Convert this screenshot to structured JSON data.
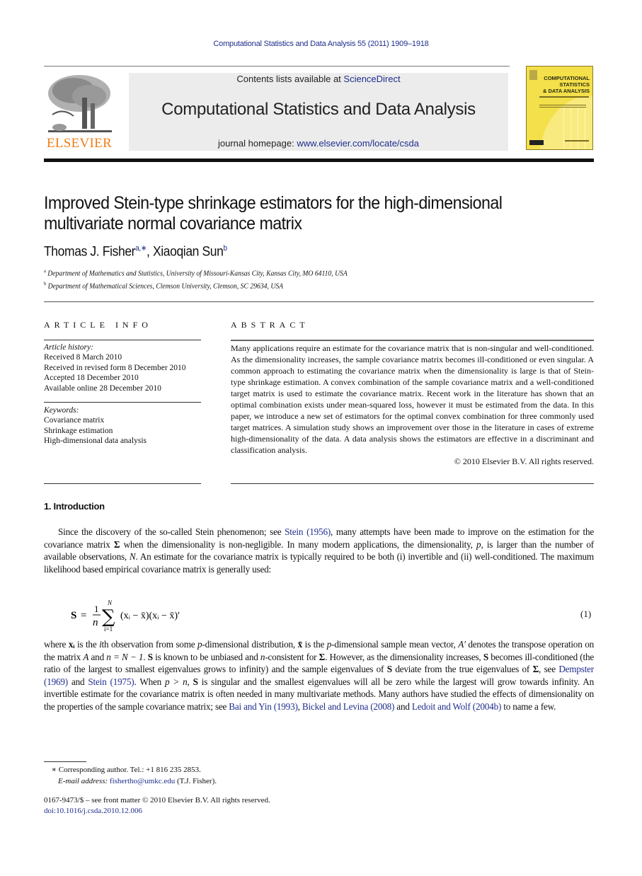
{
  "header": {
    "running_head": "Computational Statistics and Data Analysis 55 (2011) 1909–1918",
    "publisher_logo_text": "ELSEVIER",
    "contents_prefix": "Contents lists available at ",
    "contents_link": "ScienceDirect",
    "journal_title": "Computational Statistics and Data Analysis",
    "homepage_prefix": "journal homepage: ",
    "homepage_link": "www.elsevier.com/locate/csda",
    "cover": {
      "line1": "COMPUTATIONAL",
      "line2": "STATISTICS",
      "line3": "& DATA ANALYSIS",
      "color": "#f3e04a"
    },
    "colors": {
      "link": "#1f2e8c",
      "elsevier_orange": "#f07d1a",
      "banner_bg": "#ececec"
    }
  },
  "article": {
    "title_line1": "Improved Stein-type shrinkage estimators for the high-dimensional",
    "title_line2": "multivariate normal covariance matrix",
    "author1": "Thomas J. Fisher",
    "author1_sup": "a,∗",
    "author_sep": ", ",
    "author2": "Xiaoqian Sun",
    "author2_sup": "b",
    "affiliations": [
      {
        "mark": "a",
        "text": "Department of Mathematics and Statistics, University of Missouri-Kansas City, Kansas City, MO 64110, USA"
      },
      {
        "mark": "b",
        "text": "Department of Mathematical Sciences, Clemson University, Clemson, SC 29634, USA"
      }
    ]
  },
  "article_info": {
    "heading": "ARTICLE INFO",
    "history_label": "Article history:",
    "history": [
      "Received 8 March 2010",
      "Received in revised form 8 December 2010",
      "Accepted 18 December 2010",
      "Available online 28 December 2010"
    ],
    "keywords_label": "Keywords:",
    "keywords": [
      "Covariance matrix",
      "Shrinkage estimation",
      "High-dimensional data analysis"
    ]
  },
  "abstract": {
    "heading": "ABSTRACT",
    "text": "Many applications require an estimate for the covariance matrix that is non-singular and well-conditioned. As the dimensionality increases, the sample covariance matrix becomes ill-conditioned or even singular. A common approach to estimating the covariance matrix when the dimensionality is large is that of Stein-type shrinkage estimation. A convex combination of the sample covariance matrix and a well-conditioned target matrix is used to estimate the covariance matrix. Recent work in the literature has shown that an optimal combination exists under mean-squared loss, however it must be estimated from the data. In this paper, we introduce a new set of estimators for the optimal convex combination for three commonly used target matrices. A simulation study shows an improvement over those in the literature in cases of extreme high-dimensionality of the data. A data analysis shows the estimators are effective in a discriminant and classification analysis.",
    "copyright": "© 2010 Elsevier B.V. All rights reserved."
  },
  "intro": {
    "heading": "1.  Introduction",
    "p1": {
      "a": "Since the discovery of the so-called Stein phenomenon; see ",
      "ref1": "Stein (1956)",
      "b": ", many attempts have been made to improve on the estimation for the covariance matrix ",
      "sigma": "Σ",
      "c": " when the dimensionality is non-negligible. In many modern applications, the dimensionality, ",
      "p": "p",
      "d": ", is larger than the number of available observations, ",
      "N": "N",
      "e": ". An estimate for the covariance matrix is typically required to be both (i) invertible and (ii) well-conditioned. The maximum likelihood based empirical covariance matrix is generally used:"
    },
    "equation": {
      "lhs": "S",
      "eq": "=",
      "frac_num": "1",
      "frac_den": "n",
      "sum_upper": "N",
      "sum_lower": "i=1",
      "body": "(x",
      "body_text": "(xᵢ − x̄)(xᵢ − x̄)′",
      "number": "(1)"
    },
    "p2": {
      "t1": "where ",
      "t2": " is the ",
      "t3": "th observation from some ",
      "t4": "-dimensional distribution, ",
      "t5": " is the ",
      "t6": "-dimensional sample mean vector, ",
      "t7": " denotes the transpose operation on the matrix ",
      "t8": " and ",
      "t9": ". ",
      "t10": " is known to be unbiased and ",
      "t11": "-consistent for ",
      "t12": ". However, as the dimensionality increases, ",
      "t13": " becomes ill-conditioned (the ratio of the largest to smallest eigenvalues grows to infinity) and the sample eigenvalues of ",
      "t14": " deviate from the true eigenvalues of ",
      "t15": ", see ",
      "ref_dempster": "Dempster (1969)",
      "t16": " and ",
      "ref_stein1975": "Stein (1975)",
      "t17": ". When ",
      "t18": " is singular and the smallest eigenvalues will all be zero while the largest will grow towards infinity. An invertible estimate for the covariance matrix is often needed in many multivariate methods. Many authors have studied the effects of dimensionality on the properties of the sample covariance matrix; see ",
      "ref_bai": "Bai and Yin (1993)",
      "t19": ", ",
      "ref_bickel": "Bickel and Levina (2008)",
      "t20": " and ",
      "ref_ledoit": "Ledoit and Wolf (2004b)",
      "t21": " to name a few.",
      "xi": "xᵢ",
      "i": "i",
      "p": "p",
      "xbar": "x̄",
      "Aprime": "A′",
      "A": "A",
      "n_eq": "n = N − 1",
      "S": "S",
      "n": "n",
      "Sigma": "Σ",
      "p_gt_n": "p > n, "
    }
  },
  "footnotes": {
    "corresponding_mark": "∗",
    "corresponding": "Corresponding author. Tel.: +1 816 235 2853.",
    "email_label": "E-mail address: ",
    "email": "fishertho@umkc.edu",
    "email_suffix": " (T.J. Fisher).",
    "issn": "0167-9473/$ – see front matter © 2010 Elsevier B.V. All rights reserved.",
    "doi": "doi:10.1016/j.csda.2010.12.006"
  }
}
